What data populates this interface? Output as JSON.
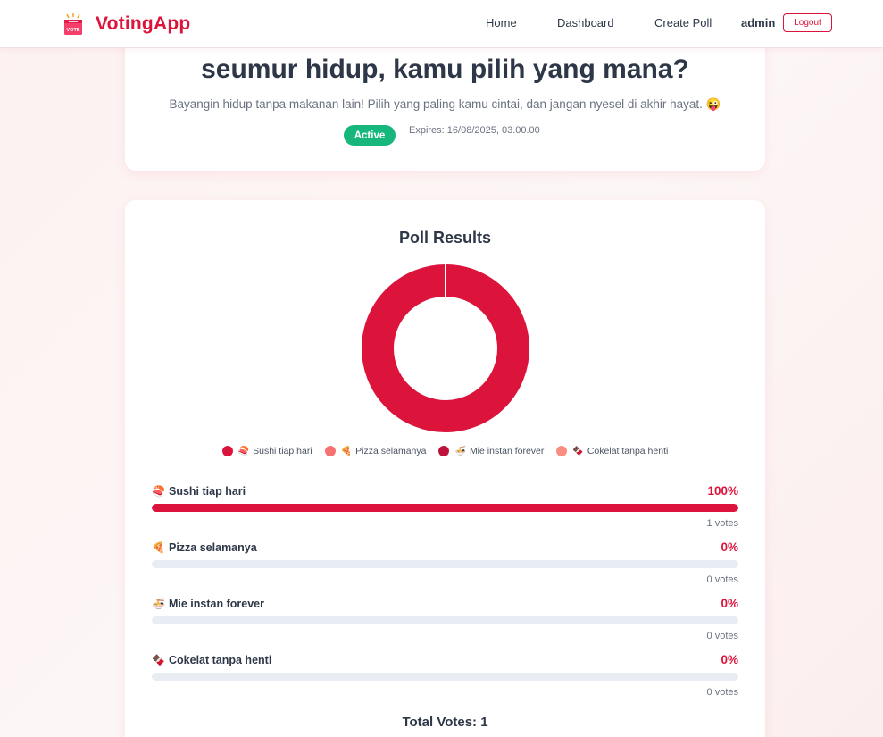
{
  "navbar": {
    "brand": "VotingApp",
    "logo_text": "VOTE",
    "links": [
      "Home",
      "Dashboard",
      "Create Poll"
    ],
    "user": "admin",
    "logout_label": "Logout"
  },
  "poll": {
    "title": "seumur hidup, kamu pilih yang mana?",
    "description": "Bayangin hidup tanpa makanan lain! Pilih yang paling kamu cintai, dan jangan nyesel di akhir hayat. 😜",
    "status": "Active",
    "expires": "Expires: 16/08/2025, 03.00.00"
  },
  "results": {
    "heading": "Poll Results",
    "total_votes": "Total Votes: 1"
  },
  "colors": {
    "accent": "#dc143c",
    "active_badge": "#16b67d",
    "legend": [
      "#dc143c",
      "#f87171",
      "#be123c",
      "#fb8c80"
    ]
  },
  "chart_data": {
    "type": "pie",
    "categories": [
      "Sushi tiap hari",
      "Pizza selamanya",
      "Mie instan forever",
      "Cokelat tanpa henti"
    ],
    "values": [
      1,
      0,
      0,
      0
    ],
    "legend_position": "bottom"
  },
  "options": [
    {
      "emoji": "🍣",
      "label": "Sushi tiap hari",
      "percent": "100%",
      "fraction": 1.0,
      "votes": "1 votes"
    },
    {
      "emoji": "🍕",
      "label": "Pizza selamanya",
      "percent": "0%",
      "fraction": 0.0,
      "votes": "0 votes"
    },
    {
      "emoji": "🍜",
      "label": "Mie instan forever",
      "percent": "0%",
      "fraction": 0.0,
      "votes": "0 votes"
    },
    {
      "emoji": "🍫",
      "label": "Cokelat tanpa henti",
      "percent": "0%",
      "fraction": 0.0,
      "votes": "0 votes"
    }
  ]
}
